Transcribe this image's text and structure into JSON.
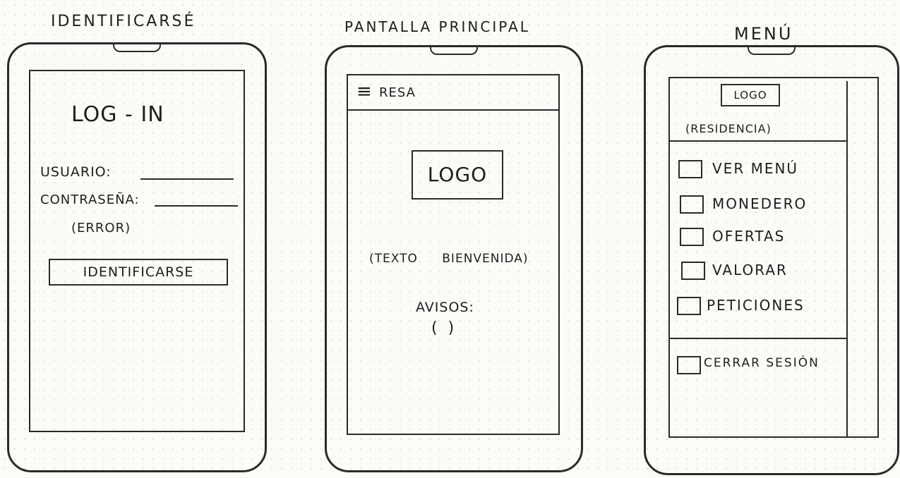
{
  "login": {
    "heading": "IDENTIFICARSÉ",
    "title": "LOG - IN",
    "user_label": "USUARIO:",
    "password_label": "CONTRASEÑA:",
    "error": "(ERROR)",
    "submit": "IDENTIFICARSE"
  },
  "home": {
    "heading": "PANTALLA PRINCIPAL",
    "hamburger": "≡",
    "brand": "RESA",
    "logo": "LOGO",
    "welcome": "(TEXTO BIENVENIDA)",
    "notices_label": "AVISOS:",
    "notices_value": "( )"
  },
  "menu": {
    "heading": "MENÚ",
    "logo": "LOGO",
    "residence": "(RESIDENCIA)",
    "items": [
      {
        "label": "VER MENÚ"
      },
      {
        "label": "MONEDERO"
      },
      {
        "label": "OFERTAS"
      },
      {
        "label": "VALORAR"
      },
      {
        "label": "PETICIONES"
      }
    ],
    "logout": "CERRAR SESIÓN"
  }
}
